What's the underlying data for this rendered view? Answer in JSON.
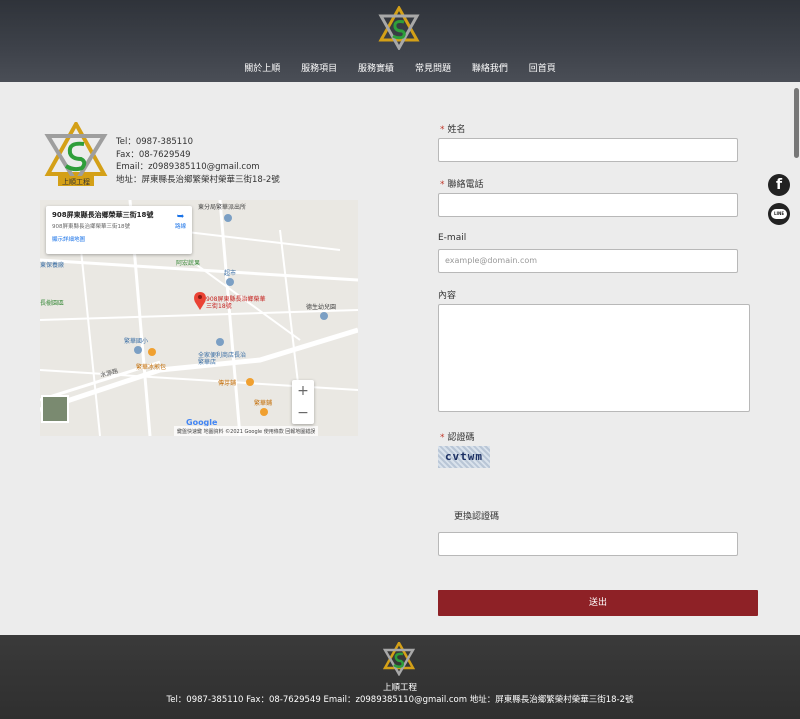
{
  "nav": {
    "items": [
      "關於上順",
      "服務項目",
      "服務實績",
      "常見問題",
      "聯絡我們",
      "回首頁"
    ]
  },
  "brand": {
    "logo_text": "上順工程",
    "logo_icon": "star-logo-icon"
  },
  "contact": {
    "tel": "Tel：0987-385110",
    "fax": "Fax：08-7629549",
    "email": "Email：z0989385110@gmail.com",
    "address": "地址：屏東縣長治鄉繁榮村榮華三街18-2號"
  },
  "map": {
    "card_title": "908屏東縣長治鄉榮華三街18號",
    "card_sub": "908屏東縣長治鄉榮華三街18號",
    "card_link": "顯示詳細地圖",
    "directions": "路線",
    "pin_label": "908屏東縣長治鄉榮華三街18號",
    "labels": {
      "police": "東分局繁華派出所",
      "a_hung": "阿宏蔬果",
      "market": "超市",
      "school": "繁華國小",
      "family": "全家便利商店長治繁華店",
      "kinder": "德生幼兒園",
      "ice": "繁華冰煎包",
      "fu": "傳芽鋪",
      "fanhua": "繁華鋪",
      "road": "水源路",
      "center": "東保養廠",
      "garden": "長樹園區"
    },
    "attribution": "鍵盤快速鍵  地圖資料 ©2021 Google  使用條款  回報地圖錯誤",
    "google": "Google",
    "zoom_in": "+",
    "zoom_out": "−"
  },
  "form": {
    "name_label": "姓名",
    "phone_label": "聯絡電話",
    "email_label": "E-mail",
    "email_placeholder": "example@domain.com",
    "content_label": "內容",
    "captcha_label": "認證碼",
    "captcha_text": "cvtwm",
    "refresh_captcha": "更換認證碼",
    "submit": "送出",
    "required_mark": "*"
  },
  "social": {
    "facebook": "f",
    "line": "LINE"
  },
  "footer": {
    "name": "上順工程",
    "info": "Tel：0987-385110  Fax：08-7629549  Email：z0989385110@gmail.com  地址：屏東縣長治鄉繁榮村榮華三街18-2號"
  }
}
